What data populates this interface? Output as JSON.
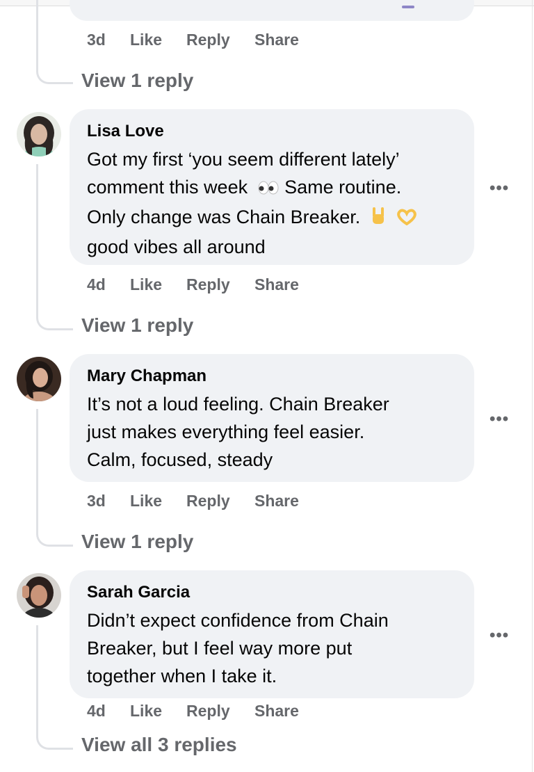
{
  "prev_comment": {
    "time": "3d",
    "like": "Like",
    "reply": "Reply",
    "share": "Share",
    "view_replies": "View 1 reply"
  },
  "comments": [
    {
      "name": "Lisa Love",
      "line1": "Got my first ‘you seem different lately’",
      "line2a": "comment this week",
      "line2b": "Same routine.",
      "line3": "Only change was Chain Breaker.",
      "line4": "good vibes all around",
      "time": "4d",
      "like": "Like",
      "reply": "Reply",
      "share": "Share",
      "more": "•••",
      "view_replies": "View 1 reply",
      "emojis": [
        "eyes-emoji",
        "rock-on-hand-emoji",
        "heart-hands-emoji"
      ]
    },
    {
      "name": "Mary Chapman",
      "line1": "It’s not a loud feeling. Chain Breaker",
      "line2": "just makes everything feel easier.",
      "line3": "Calm, focused, steady",
      "time": "3d",
      "like": "Like",
      "reply": "Reply",
      "share": "Share",
      "more": "•••",
      "view_replies": "View 1 reply"
    },
    {
      "name": "Sarah Garcia",
      "line1": "Didn’t expect confidence from Chain",
      "line2": "Breaker, but I feel way more put",
      "line3": "together when I take it.",
      "time": "4d",
      "like": "Like",
      "reply": "Reply",
      "share": "Share",
      "more": "•••",
      "view_replies": "View all 3 replies"
    }
  ],
  "colors": {
    "bubble": "#f0f2f5",
    "meta_text": "#65676b",
    "body_text": "#050505",
    "thread_line": "#dfe1e5"
  }
}
